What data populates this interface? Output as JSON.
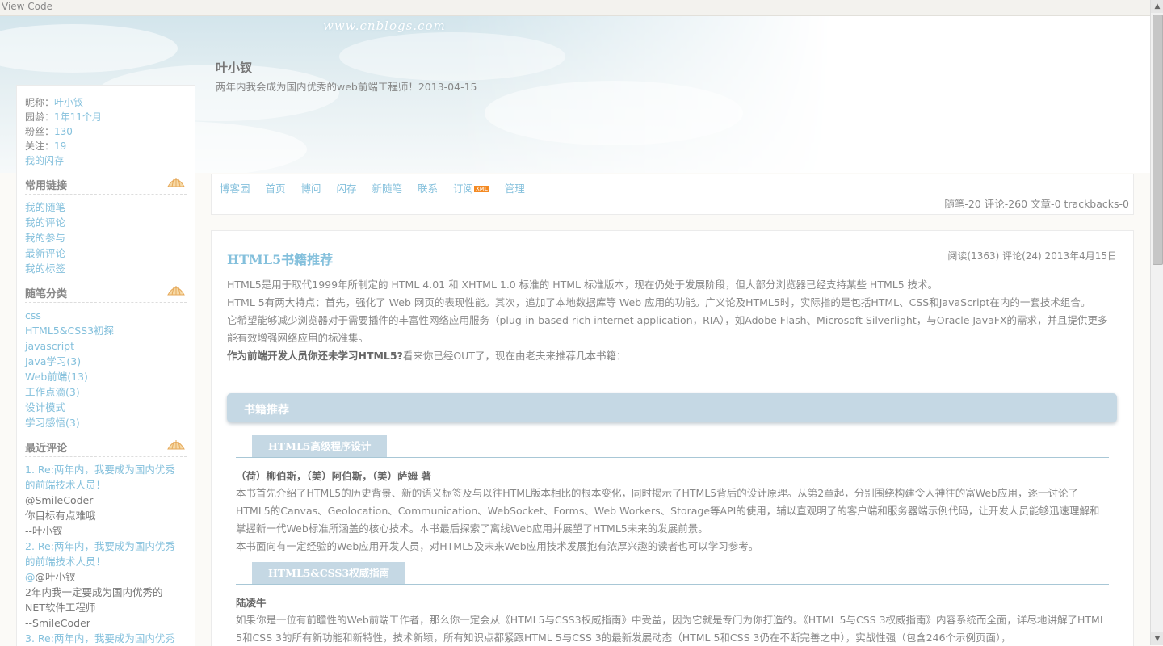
{
  "topbar": {
    "view_code": "View Code"
  },
  "header": {
    "watermark": "www.cnblogs.com",
    "blog_title": "叶小钗",
    "subtitle": "两年内我会成为国内优秀的web前端工程师！2013-04-15"
  },
  "profile": {
    "nickname_label": "昵称：",
    "nickname": "叶小钗",
    "age_label": "园龄：",
    "age": "1年11个月",
    "fans_label": "粉丝：",
    "fans": "130",
    "follow_label": "关注：",
    "follow": "19",
    "flash_link": "我的闪存"
  },
  "links_section": {
    "title": "常用链接",
    "items": [
      "我的随笔",
      "我的评论",
      "我的参与",
      "最新评论",
      "我的标签"
    ]
  },
  "category_section": {
    "title": "随笔分类",
    "items": [
      "css",
      "HTML5&CSS3初探",
      "javascript",
      "Java学习(3)",
      "Web前端(13)",
      "工作点滴(3)",
      "设计模式",
      "学习感悟(3)"
    ]
  },
  "comments_section": {
    "title": "最近评论",
    "items": [
      {
        "title_1": "1. Re:两年内，我要成为国内优秀",
        "title_2": "的前端技术人员！",
        "author": "@SmileCoder",
        "body_1": "你目标有点难哦",
        "body_2": "--叶小钗"
      },
      {
        "title_1": "2. Re:两年内，我要成为国内优秀",
        "title_2": "的前端技术人员！",
        "author": "@叶小钗",
        "body_1": "2年内我一定要成为国内优秀的",
        "body_2": "NET软件工程师",
        "body_3": "--SmileCoder"
      },
      {
        "title_1": "3. Re:两年内，我要成为国内优秀"
      }
    ]
  },
  "nav": {
    "links": [
      "博客园",
      "首页",
      "博问",
      "闪存",
      "新随笔",
      "联系",
      "订阅",
      "管理"
    ],
    "xml_badge": "XML",
    "stats": "随笔-20 评论-260 文章-0 trackbacks-0"
  },
  "post": {
    "title": "HTML5书籍推荐",
    "meta": "阅读(1363) 评论(24) 2013年4月15日",
    "para1": "HTML5是用于取代1999年所制定的 HTML 4.01 和 XHTML 1.0 标准的 HTML 标准版本，现在仍处于发展阶段，但大部分浏览器已经支持某些 HTML5 技术。",
    "para2": "HTML 5有两大特点：首先，强化了 Web 网页的表现性能。其次，追加了本地数据库等 Web 应用的功能。广义论及HTML5时，实际指的是包括HTML、CSS和JavaScript在内的一套技术组合。",
    "para3": "它希望能够减少浏览器对于需要插件的丰富性网络应用服务（plug-in-based rich internet application，RIA），如Adobe Flash、Microsoft Silverlight，与Oracle JavaFX的需求，并且提供更多能有效增强网络应用的标准集。",
    "para4_bold": "作为前端开发人员你还未学习HTML5?",
    "para4_rest": "看来你已经OUT了，现在由老夫来推荐几本书籍：",
    "section_title": "书籍推荐",
    "books": [
      {
        "tab": "HTML5高级程序设计",
        "author": "（荷）柳伯斯，（美）阿伯斯，（美）萨姆 著",
        "text1": "本书首先介绍了HTML5的历史背景、新的语义标签及与以往HTML版本相比的根本变化，同时揭示了HTML5背后的设计原理。从第2章起，分别围绕构建令人神往的富Web应用，逐一讨论了HTML5的Canvas、Geolocation、Communication、WebSocket、Forms、Web Workers、Storage等API的使用，辅以直观明了的客户端和服务器端示例代码，让开发人员能够迅速理解和掌握新一代Web标准所涵盖的核心技术。本书最后探索了离线Web应用并展望了HTML5未来的发展前景。",
        "text2": "本书面向有一定经验的Web应用开发人员，对HTML5及未来Web应用技术发展抱有浓厚兴趣的读者也可以学习参考。"
      },
      {
        "tab": "HTML5&CSS3权威指南",
        "author": "陆凌牛",
        "text1": "如果你是一位有前瞻性的Web前端工作者，那么你一定会从《HTML5与CSS3权威指南》中受益，因为它就是专门为你打造的。《HTML 5与CSS 3权威指南》内容系统而全面，详尽地讲解了HTML 5和CSS 3的所有新功能和新特性，技术新颖，所有知识点都紧跟HTML 5与CSS 3的最新发展动态（HTML 5和CSS 3仍在不断完善之中），实战性强（包含246个示例页面），"
      }
    ]
  }
}
